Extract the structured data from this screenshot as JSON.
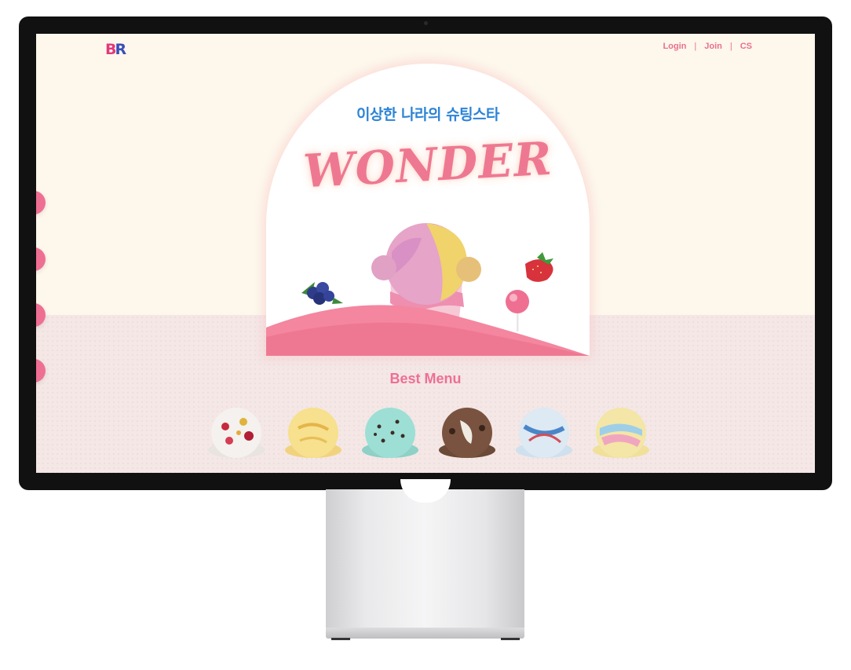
{
  "header": {
    "logo_text_b": "B",
    "logo_text_r": "R",
    "nav": [
      "Login",
      "Join",
      "CS"
    ],
    "separator": "|"
  },
  "hero": {
    "subtitle": "이상한 나라의 슈팅스타",
    "title": "WONDER"
  },
  "best_menu": {
    "title": "Best Menu",
    "items": [
      {
        "icon": "cherry-jubilee-scoop-icon"
      },
      {
        "icon": "yellow-cream-scoop-icon"
      },
      {
        "icon": "mint-chocolate-chip-scoop-icon"
      },
      {
        "icon": "chocolate-cookie-scoop-icon"
      },
      {
        "icon": "blue-swirl-scoop-icon"
      },
      {
        "icon": "rainbow-sherbet-scoop-icon"
      }
    ]
  },
  "colors": {
    "brand_pink": "#ef6f93",
    "brand_blue": "#2c84d6",
    "hero_bg": "#fdf7ec",
    "band_bg": "#f4e7e6"
  }
}
